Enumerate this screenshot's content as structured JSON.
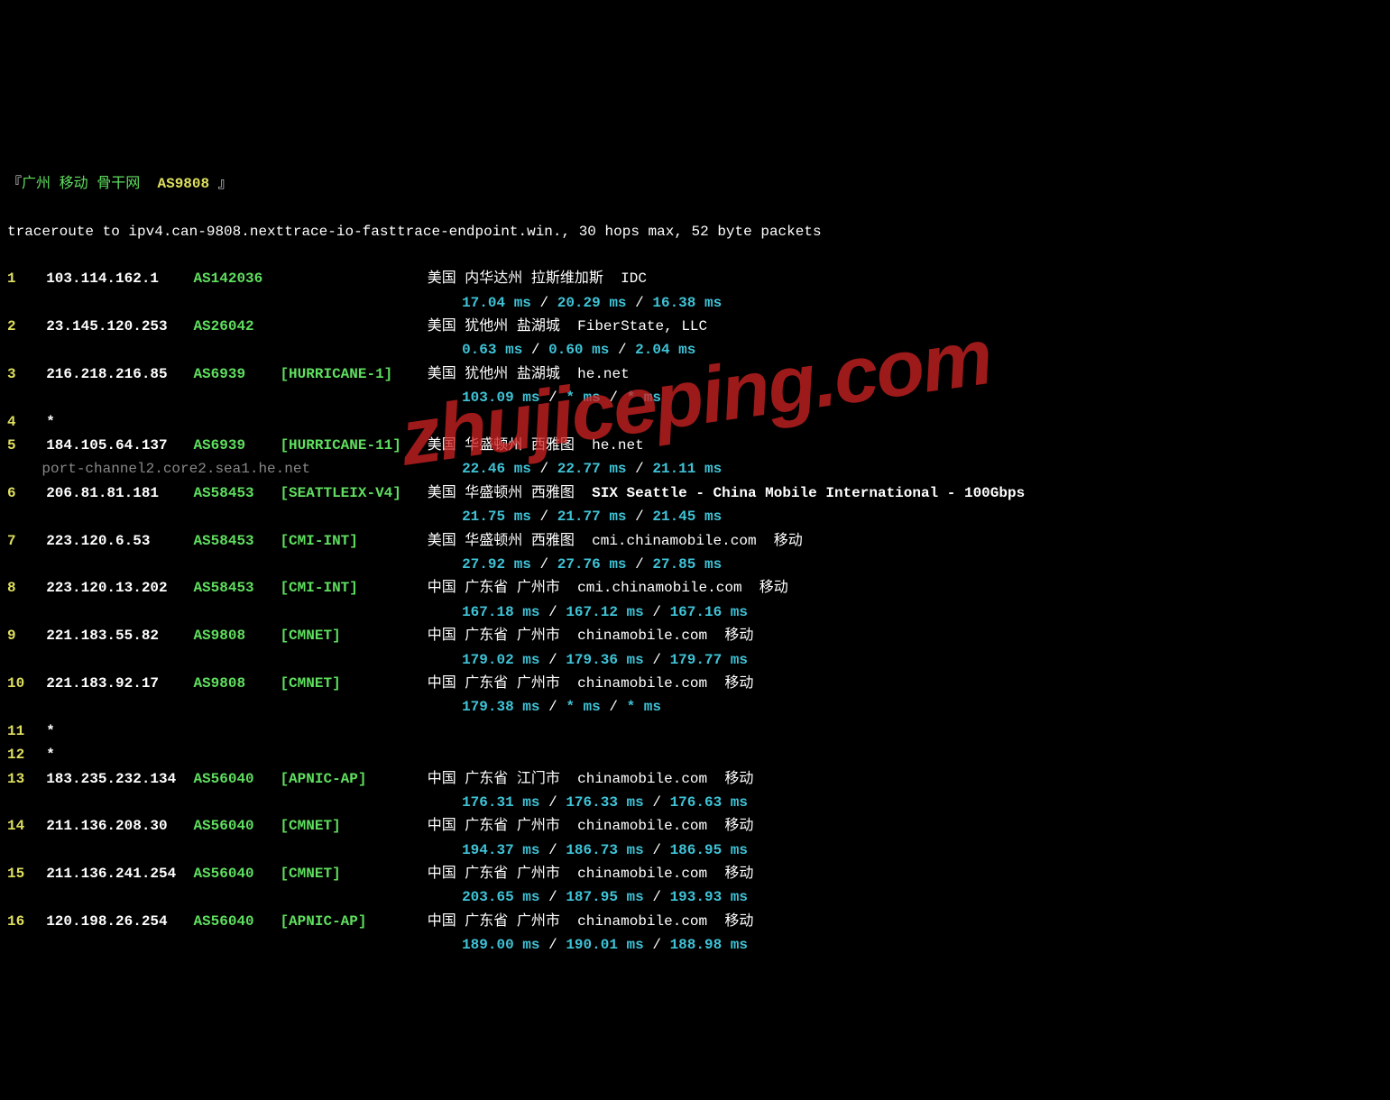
{
  "header": {
    "bracket_open": "『",
    "city": "广州",
    "carrier": "移动",
    "network": "骨干网",
    "asn": "AS9808",
    "bracket_close": "』"
  },
  "command": "traceroute to ipv4.can-9808.nexttrace-io-fasttrace-endpoint.win., 30 hops max, 52 byte packets",
  "hops": [
    {
      "num": "1",
      "ip": "103.114.162.1",
      "asn": "AS142036",
      "netname": "",
      "loc": "美国 内华达州 拉斯维加斯",
      "owner": "IDC",
      "rtt": [
        "17.04 ms",
        "20.29 ms",
        "16.38 ms"
      ],
      "rdns": ""
    },
    {
      "num": "2",
      "ip": "23.145.120.253",
      "asn": "AS26042",
      "netname": "",
      "loc": "美国 犹他州 盐湖城",
      "owner": "FiberState, LLC",
      "rtt": [
        "0.63 ms",
        "0.60 ms",
        "2.04 ms"
      ],
      "rdns": ""
    },
    {
      "num": "3",
      "ip": "216.218.216.85",
      "asn": "AS6939",
      "netname": "[HURRICANE-1]",
      "loc": "美国 犹他州 盐湖城",
      "owner": "he.net",
      "rtt": [
        "103.09 ms",
        "* ms",
        "* ms"
      ],
      "rdns": ""
    },
    {
      "num": "4",
      "ip": "*",
      "asn": "",
      "netname": "",
      "loc": "",
      "owner": "",
      "rtt": [],
      "rdns": ""
    },
    {
      "num": "5",
      "ip": "184.105.64.137",
      "asn": "AS6939",
      "netname": "[HURRICANE-11]",
      "loc": "美国 华盛顿州 西雅图",
      "owner": "he.net",
      "rtt": [
        "22.46 ms",
        "22.77 ms",
        "21.11 ms"
      ],
      "rdns": "port-channel2.core2.sea1.he.net"
    },
    {
      "num": "6",
      "ip": "206.81.81.181",
      "asn": "AS58453",
      "netname": "[SEATTLEIX-V4]",
      "loc": "美国 华盛顿州 西雅图",
      "owner": "SIX Seattle - China Mobile International - 100Gbps",
      "owner_bold": true,
      "rtt": [
        "21.75 ms",
        "21.77 ms",
        "21.45 ms"
      ],
      "rdns": ""
    },
    {
      "num": "7",
      "ip": "223.120.6.53",
      "asn": "AS58453",
      "netname": "[CMI-INT]",
      "loc": "美国 华盛顿州 西雅图",
      "owner": "cmi.chinamobile.com  移动",
      "rtt": [
        "27.92 ms",
        "27.76 ms",
        "27.85 ms"
      ],
      "rdns": ""
    },
    {
      "num": "8",
      "ip": "223.120.13.202",
      "asn": "AS58453",
      "netname": "[CMI-INT]",
      "loc": "中国 广东省 广州市",
      "owner": "cmi.chinamobile.com  移动",
      "rtt": [
        "167.18 ms",
        "167.12 ms",
        "167.16 ms"
      ],
      "rdns": ""
    },
    {
      "num": "9",
      "ip": "221.183.55.82",
      "asn": "AS9808",
      "netname": "[CMNET]",
      "loc": "中国 广东省 广州市",
      "owner": "chinamobile.com  移动",
      "rtt": [
        "179.02 ms",
        "179.36 ms",
        "179.77 ms"
      ],
      "rdns": ""
    },
    {
      "num": "10",
      "ip": "221.183.92.17",
      "asn": "AS9808",
      "netname": "[CMNET]",
      "loc": "中国 广东省 广州市",
      "owner": "chinamobile.com  移动",
      "rtt": [
        "179.38 ms",
        "* ms",
        "* ms"
      ],
      "rdns": ""
    },
    {
      "num": "11",
      "ip": "*",
      "asn": "",
      "netname": "",
      "loc": "",
      "owner": "",
      "rtt": [],
      "rdns": ""
    },
    {
      "num": "12",
      "ip": "*",
      "asn": "",
      "netname": "",
      "loc": "",
      "owner": "",
      "rtt": [],
      "rdns": ""
    },
    {
      "num": "13",
      "ip": "183.235.232.134",
      "asn": "AS56040",
      "netname": "[APNIC-AP]",
      "loc": "中国 广东省 江门市",
      "owner": "chinamobile.com  移动",
      "rtt": [
        "176.31 ms",
        "176.33 ms",
        "176.63 ms"
      ],
      "rdns": ""
    },
    {
      "num": "14",
      "ip": "211.136.208.30",
      "asn": "AS56040",
      "netname": "[CMNET]",
      "loc": "中国 广东省 广州市",
      "owner": "chinamobile.com  移动",
      "rtt": [
        "194.37 ms",
        "186.73 ms",
        "186.95 ms"
      ],
      "rdns": ""
    },
    {
      "num": "15",
      "ip": "211.136.241.254",
      "asn": "AS56040",
      "netname": "[CMNET]",
      "loc": "中国 广东省 广州市",
      "owner": "chinamobile.com  移动",
      "rtt": [
        "203.65 ms",
        "187.95 ms",
        "193.93 ms"
      ],
      "rdns": ""
    },
    {
      "num": "16",
      "ip": "120.198.26.254",
      "asn": "AS56040",
      "netname": "[APNIC-AP]",
      "loc": "中国 广东省 广州市",
      "owner": "chinamobile.com  移动",
      "rtt": [
        "189.00 ms",
        "190.01 ms",
        "188.98 ms"
      ],
      "rdns": ""
    }
  ],
  "watermark": "zhujiceping.com"
}
